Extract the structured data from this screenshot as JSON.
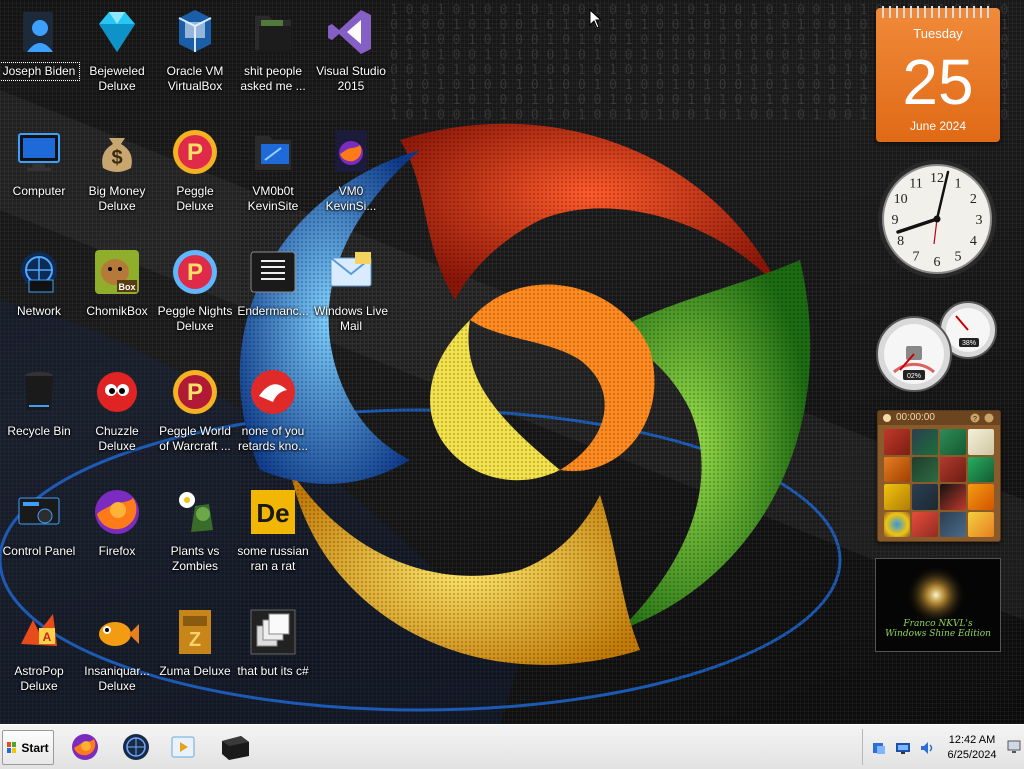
{
  "desktop": {
    "icons": [
      {
        "label": "Joseph Biden",
        "icon": "user-folder-icon"
      },
      {
        "label": "Bejeweled Deluxe",
        "icon": "diamond-gem-icon"
      },
      {
        "label": "Oracle VM VirtualBox",
        "icon": "virtualbox-icon"
      },
      {
        "label": "shit people asked me ...",
        "icon": "folder-icon"
      },
      {
        "label": "Visual Studio 2015",
        "icon": "visual-studio-icon"
      },
      {
        "label": "Computer",
        "icon": "computer-monitor-icon"
      },
      {
        "label": "Big Money Deluxe",
        "icon": "money-bag-icon"
      },
      {
        "label": "Peggle Deluxe",
        "icon": "peggle-icon"
      },
      {
        "label": "VM0b0t KevinSite",
        "icon": "folder-monitor-icon"
      },
      {
        "label": "VM0 KevinSi...",
        "icon": "firefox-document-icon"
      },
      {
        "label": "Network",
        "icon": "network-globe-icon"
      },
      {
        "label": "ChomikBox",
        "icon": "chomikbox-hamster-icon"
      },
      {
        "label": "Peggle Nights Deluxe",
        "icon": "peggle-nights-icon"
      },
      {
        "label": "Endermanc...",
        "icon": "text-document-icon"
      },
      {
        "label": "Windows Live Mail",
        "icon": "mail-envelope-icon"
      },
      {
        "label": "Recycle Bin",
        "icon": "recycle-bin-icon"
      },
      {
        "label": "Chuzzle Deluxe",
        "icon": "chuzzle-icon"
      },
      {
        "label": "Peggle World of Warcraft ...",
        "icon": "peggle-wow-icon"
      },
      {
        "label": "none of you retards kno...",
        "icon": "red-circle-mascot-icon"
      },
      {
        "label": "Control Panel",
        "icon": "control-panel-icon"
      },
      {
        "label": "Firefox",
        "icon": "firefox-icon"
      },
      {
        "label": "Plants vs Zombies",
        "icon": "plants-vs-zombies-icon"
      },
      {
        "label": "some russian ran a rat",
        "icon": "de-logo-icon"
      },
      {
        "label": "AstroPop Deluxe",
        "icon": "astropop-icon"
      },
      {
        "label": "Insaniquar... Deluxe",
        "icon": "goldfish-icon"
      },
      {
        "label": "Zuma Deluxe",
        "icon": "zuma-idol-icon"
      },
      {
        "label": "that but its c#",
        "icon": "stacked-windows-icon"
      }
    ]
  },
  "gadgets": {
    "calendar": {
      "weekday": "Tuesday",
      "day": "25",
      "month_year": "June 2024"
    },
    "clock": {
      "numerals": [
        "12",
        "1",
        "2",
        "3",
        "4",
        "5",
        "6",
        "7",
        "8",
        "9",
        "10",
        "11"
      ]
    },
    "cpu_meter": {
      "cpu_percent": "02%",
      "memory_percent": "38%"
    },
    "puzzle": {
      "timer": "00:00:00"
    },
    "slideshow": {
      "caption_line1": "Franco NKVL's",
      "caption_line2": "Windows Shine Edition"
    }
  },
  "taskbar": {
    "start_label": "Start",
    "pinned": [
      {
        "icon": "firefox-icon"
      },
      {
        "icon": "globe-icon"
      },
      {
        "icon": "media-player-icon"
      },
      {
        "icon": "black-window-icon"
      }
    ],
    "tray": {
      "time": "12:42 AM",
      "date": "6/25/2024"
    }
  },
  "colors": {
    "calendar_orange": "#e8761f",
    "taskbar_bg": "#ececec"
  }
}
